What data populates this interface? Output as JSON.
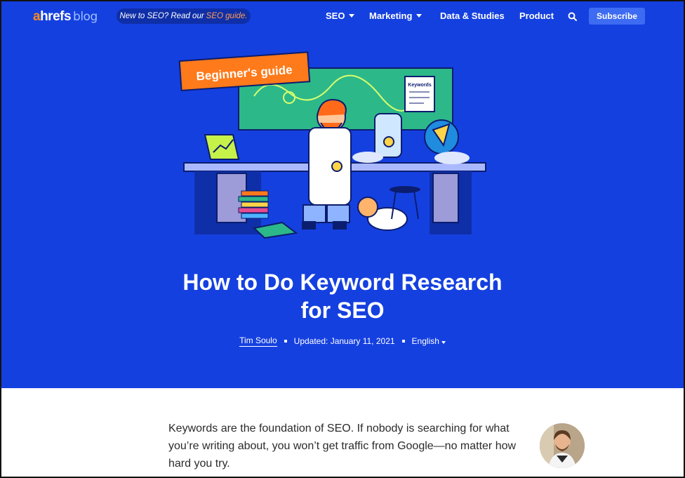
{
  "header": {
    "logo": {
      "a": "a",
      "hrefs": "hrefs",
      "blog": "blog"
    },
    "promo": {
      "text": "New to SEO? Read our",
      "link": "SEO guide."
    },
    "nav": [
      {
        "label": "SEO",
        "dropdown": true
      },
      {
        "label": "Marketing",
        "dropdown": true
      },
      {
        "label": "Data & Studies",
        "dropdown": false
      },
      {
        "label": "Product",
        "dropdown": false
      }
    ],
    "subscribe_label": "Subscribe"
  },
  "hero": {
    "badge": "Beginner's guide",
    "board_label": "Keywords",
    "title_line1": "How to Do Keyword Research",
    "title_line2": "for SEO"
  },
  "meta": {
    "author": "Tim Soulo",
    "updated": "Updated: January 11, 2021",
    "language": "English"
  },
  "article": {
    "intro": "Keywords are the foundation of SEO. If nobody is searching for what you’re writing about, you won’t get traffic from Google—no matter how hard you try."
  },
  "colors": {
    "hero_bg": "#1540e0",
    "accent_orange": "#ff8a1d",
    "subscribe_bg": "#3d6bf2"
  }
}
